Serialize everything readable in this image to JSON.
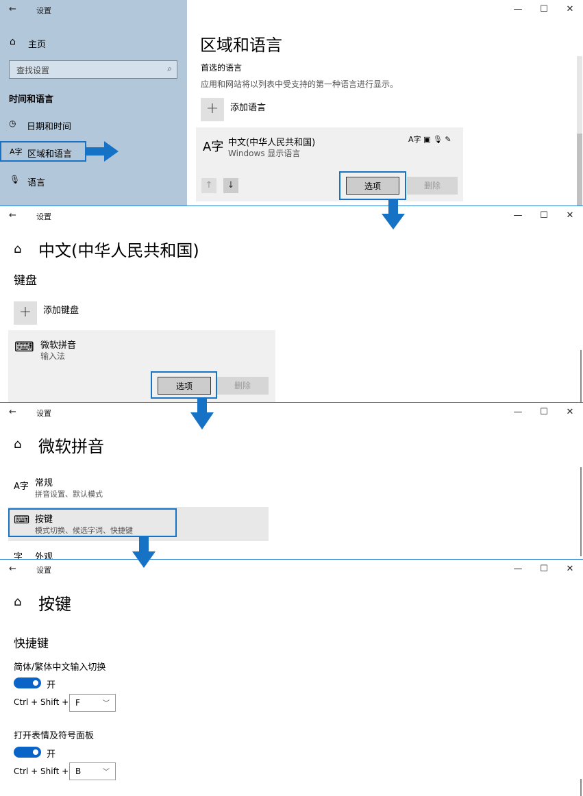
{
  "panel1": {
    "caption": "设置",
    "sidebar": {
      "home": "主页",
      "search_placeholder": "查找设置",
      "section": "时间和语言",
      "items": [
        "日期和时间",
        "区域和语言",
        "语言"
      ]
    },
    "title": "区域和语言",
    "preferred_heading": "首选的语言",
    "preferred_desc": "应用和网站将以列表中受支持的第一种语言进行显示。",
    "add_language": "添加语言",
    "language_name": "中文(中华人民共和国)",
    "language_sub": "Windows 显示语言",
    "options_btn": "选项",
    "remove_btn": "删除"
  },
  "panel2": {
    "caption": "设置",
    "title": "中文(中华人民共和国)",
    "keyboard_heading": "键盘",
    "add_keyboard": "添加键盘",
    "ime_name": "微软拼音",
    "ime_sub": "输入法",
    "options_btn": "选项",
    "remove_btn": "删除"
  },
  "panel3": {
    "caption": "设置",
    "title": "微软拼音",
    "items": [
      {
        "label": "常规",
        "sub": "拼音设置、默认模式"
      },
      {
        "label": "按键",
        "sub": "模式切换、候选字词、快捷键"
      },
      {
        "label": "外观",
        "sub": ""
      }
    ]
  },
  "panel4": {
    "caption": "设置",
    "title": "按键",
    "shortcuts_heading": "快捷键",
    "setting1": {
      "label": "简体/繁体中文输入切换",
      "state": "开",
      "combo": "Ctrl + Shift +",
      "key": "F"
    },
    "setting2": {
      "label": "打开表情及符号面板",
      "state": "开",
      "combo": "Ctrl + Shift +",
      "key": "B"
    }
  },
  "window_controls": {
    "minimize": "—",
    "maximize": "☐",
    "close": "✕"
  },
  "back_glyph": "←",
  "home_glyph": "⌂",
  "colors": {
    "accent": "#0a64c8",
    "highlight": "#1672c4",
    "sidebar": "#b3c7da"
  }
}
